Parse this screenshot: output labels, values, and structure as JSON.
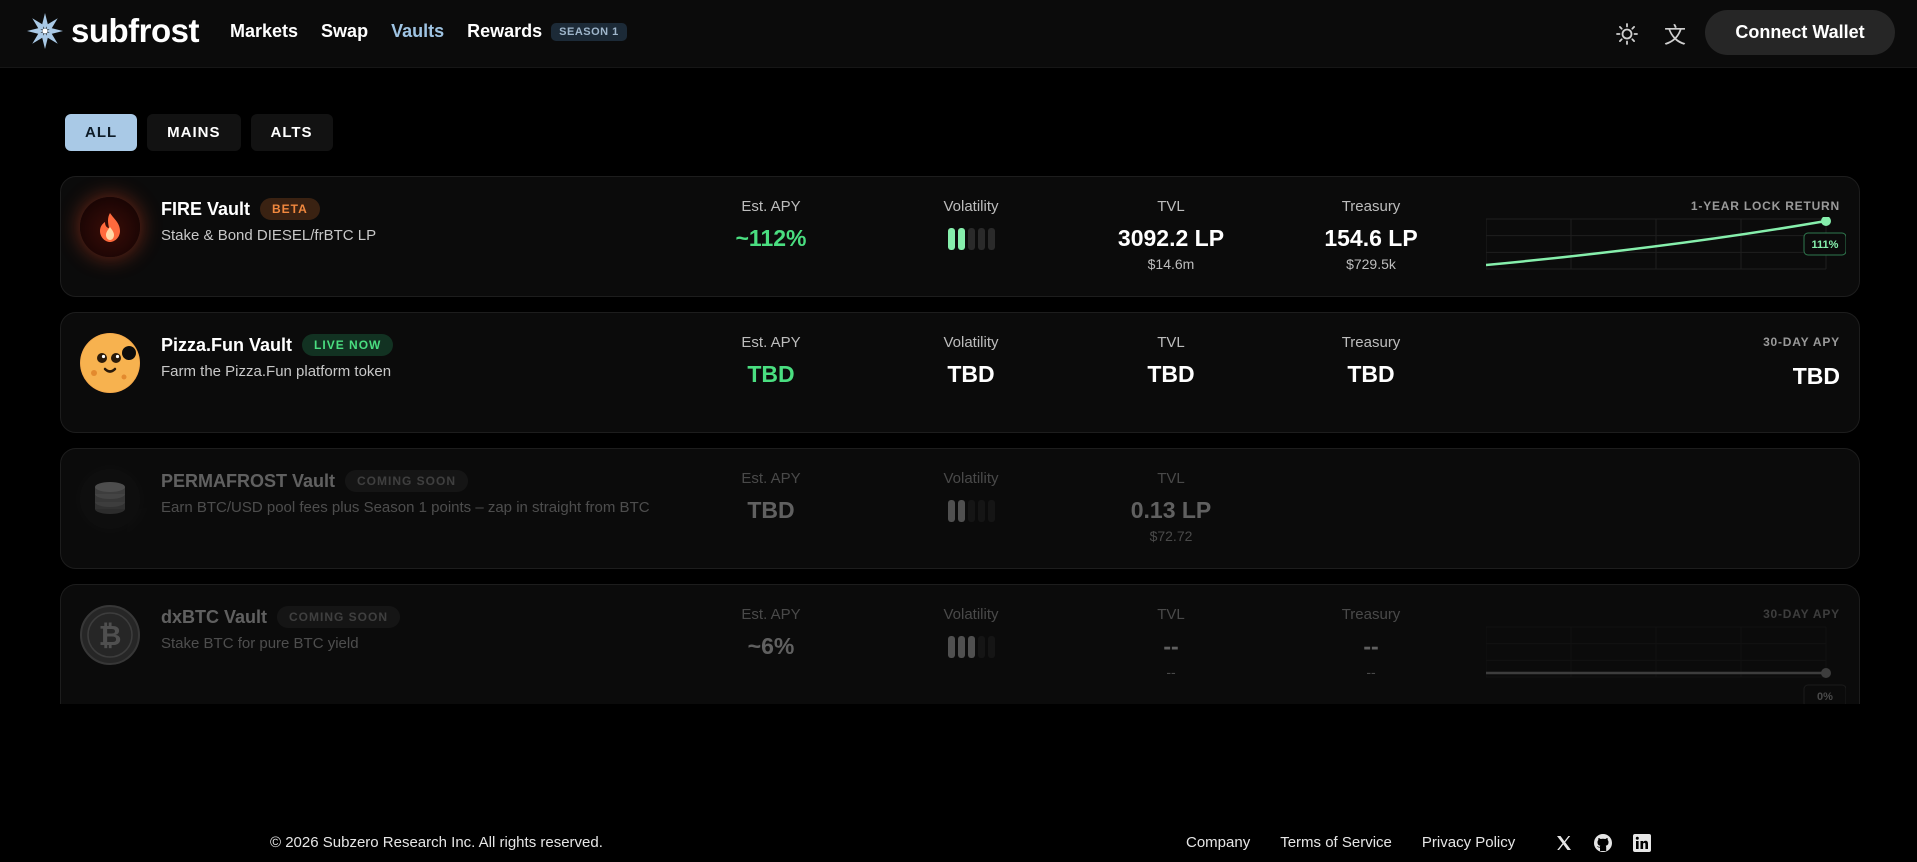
{
  "nav": {
    "brand": "subfrost",
    "links": [
      "Markets",
      "Swap",
      "Vaults",
      "Rewards"
    ],
    "season_badge": "SEASON 1",
    "connect": "Connect Wallet",
    "accent": "#9fc4e3"
  },
  "filters": [
    "ALL",
    "MAINS",
    "ALTS"
  ],
  "vaults": [
    {
      "name": "FIRE Vault",
      "badge": "BETA",
      "desc": "Stake & Bond DIESEL/frBTC LP",
      "apy_label": "Est. APY",
      "apy": "~112%",
      "vol_label": "Volatility",
      "volatility_level": 2,
      "volatility_max": 5,
      "tvl_label": "TVL",
      "tvl": "3092.2 LP",
      "tvl_usd": "$14.6m",
      "tre_label": "Treasury",
      "treasury": "154.6 LP",
      "treasury_usd": "$729.5k",
      "right_label": "1-YEAR LOCK RETURN",
      "chart_tag": "111%",
      "icon": "fire-icon"
    },
    {
      "name": "Pizza.Fun Vault",
      "badge": "LIVE NOW",
      "desc": "Farm the Pizza.Fun platform token",
      "apy_label": "Est. APY",
      "apy": "TBD",
      "vol_label": "Volatility",
      "volatility": "TBD",
      "tvl_label": "TVL",
      "tvl": "TBD",
      "tre_label": "Treasury",
      "treasury": "TBD",
      "right_label": "30-DAY APY",
      "right_value": "TBD",
      "icon": "pizza-face-icon"
    },
    {
      "name": "PERMAFROST Vault",
      "badge": "COMING SOON",
      "desc": "Earn BTC/USD pool fees plus Season 1 points – zap in straight from BTC",
      "apy_label": "Est. APY",
      "apy": "TBD",
      "vol_label": "Volatility",
      "volatility_level": 2,
      "volatility_max": 5,
      "tvl_label": "TVL",
      "tvl": "0.13 LP",
      "tvl_usd": "$72.72",
      "icon": "coin-stack-icon"
    },
    {
      "name": "dxBTC Vault",
      "badge": "COMING SOON",
      "desc": "Stake BTC for pure BTC yield",
      "apy_label": "Est. APY",
      "apy": "~6%",
      "vol_label": "Volatility",
      "volatility_level": 3,
      "volatility_max": 5,
      "tvl_label": "TVL",
      "tvl": "--",
      "tvl_usd": "--",
      "tre_label": "Treasury",
      "treasury": "--",
      "treasury_usd": "--",
      "right_label": "30-DAY APY",
      "chart_tag": "0%",
      "icon": "bitcoin-icon"
    }
  ],
  "chart_data": [
    {
      "type": "line",
      "x": [
        0,
        1
      ],
      "y": [
        0,
        111
      ],
      "ylim": [
        0,
        111
      ],
      "grid": true,
      "end_label": "111%",
      "color": "#86efac"
    },
    {
      "type": "line",
      "x": [
        0,
        1
      ],
      "y": [
        0,
        0
      ],
      "ylim": [
        0,
        1
      ],
      "grid": true,
      "end_label": "0%",
      "color": "#9a9a9a"
    }
  ],
  "footer": {
    "copyright": "© 2026 Subzero Research Inc. All rights reserved.",
    "links": [
      "Company",
      "Terms of Service",
      "Privacy Policy"
    ]
  }
}
